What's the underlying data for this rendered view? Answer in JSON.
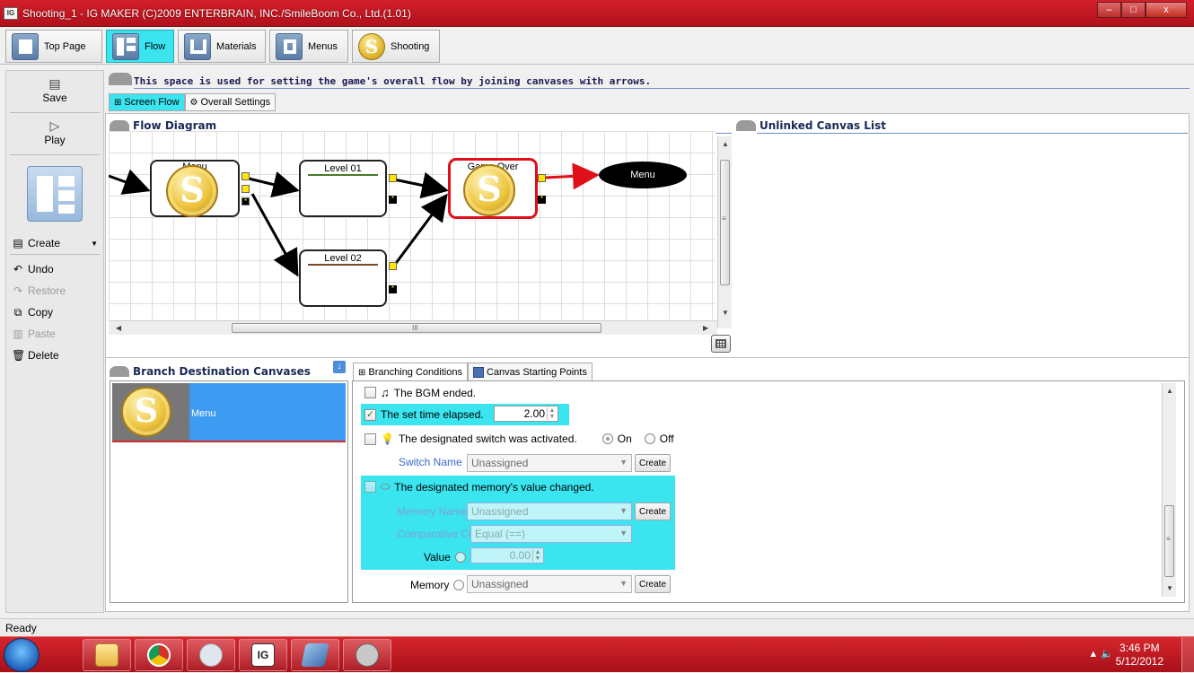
{
  "window": {
    "title": "Shooting_1 - IG MAKER (C)2009 ENTERBRAIN, INC./SmileBoom Co., Ltd.(1.01)",
    "app_icon": "IG",
    "minimize": "–",
    "maximize": "□",
    "close": "x"
  },
  "top_tabs": [
    {
      "label": "Top Page",
      "icon": "home-icon"
    },
    {
      "label": "Flow",
      "icon": "flow-icon",
      "active": true
    },
    {
      "label": "Materials",
      "icon": "materials-icon"
    },
    {
      "label": "Menus",
      "icon": "menus-icon"
    },
    {
      "label": "Shooting",
      "icon": "shooting-icon"
    }
  ],
  "toolbar": {
    "save": "Save",
    "play": "Play",
    "create": "Create",
    "undo": "Undo",
    "restore": "Restore",
    "copy": "Copy",
    "paste": "Paste",
    "delete": "Delete"
  },
  "main": {
    "description": "This space is used for setting the game's overall flow by joining canvases with arrows.",
    "tabs": [
      "Screen Flow",
      "Overall Settings"
    ]
  },
  "flow": {
    "heading": "Flow Diagram",
    "unlinked_heading": "Unlinked Canvas List",
    "nodes": {
      "menu": "Menu",
      "level01": "Level 01",
      "level02": "Level 02",
      "gameover": "Game Over",
      "menu_ellipse": "Menu",
      "coin_letter": "S"
    },
    "hscroll_grip": "III",
    "vscroll_grip": "≡"
  },
  "branch": {
    "heading": "Branch Destination Canvases",
    "items": [
      {
        "label": "Menu"
      }
    ]
  },
  "conditions": {
    "tabs": [
      "Branching Conditions",
      "Canvas Starting Points"
    ],
    "bgm_ended": "The BGM ended.",
    "time_elapsed": "The set time elapsed.",
    "time_value": "2.00",
    "switch_activated": "The designated switch was activated.",
    "on_label": "On",
    "off_label": "Off",
    "switch_name_label": "Switch Name",
    "switch_name_value": "Unassigned",
    "create": "Create",
    "memory_changed": "The designated memory's value changed.",
    "memory_name_label": "Memory Name",
    "memory_name_value": "Unassigned",
    "comparative_label": "Comparative Condition",
    "comparative_value": "Equal (==)",
    "value_label": "Value",
    "value_number": "0.00",
    "memory_label": "Memory",
    "memory_value": "Unassigned"
  },
  "status": "Ready",
  "taskbar": {
    "time": "3:46 PM",
    "date": "5/12/2012"
  },
  "colors": {
    "accent_cyan": "#3ae5f0",
    "title_red": "#c0141e",
    "selection_blue": "#3d9cf2"
  }
}
